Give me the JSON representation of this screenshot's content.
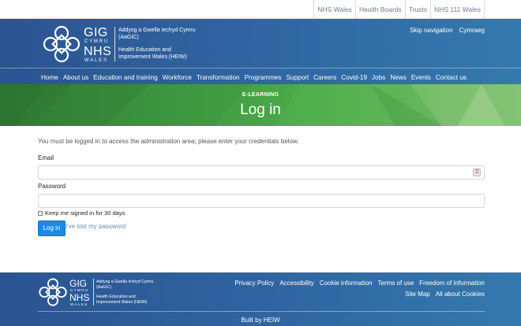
{
  "topbar": {
    "links": [
      "NHS Wales",
      "Health Boards",
      "Trusts",
      "NHS 111 Wales"
    ]
  },
  "header": {
    "logo": {
      "gig": "GIG",
      "cymru": "CYMRU",
      "nhs": "NHS",
      "wales": "WALES",
      "welsh_name": "Addysg a Gwella Iechyd Cymru (AaGIC)",
      "english_name": "Health Education and Improvement Wales (HEIW)"
    },
    "skip_nav": "Skip navigation",
    "language": "Cymraeg"
  },
  "nav": {
    "items": [
      "Home",
      "About us",
      "Education and training",
      "Workforce",
      "Transformation",
      "Programmes",
      "Support",
      "Careers",
      "Covid-19",
      "Jobs",
      "News",
      "Events",
      "Contact us"
    ]
  },
  "hero": {
    "kicker": "E-LEARNING",
    "title": "Log in"
  },
  "login": {
    "notice": "You must be logged in to access the administration area; please enter your credentials below.",
    "email_label": "Email",
    "email_value": "",
    "password_label": "Password",
    "password_value": "",
    "remember_label": "Keep me signed in for 30 days",
    "remember_checked": false,
    "submit_label": "Log in",
    "lost_password": "I've lost my password"
  },
  "footer": {
    "links": [
      "Privacy Policy",
      "Accessibility",
      "Cookie information",
      "Terms of use",
      "Freedom of information",
      "Site Map",
      "All about Cookies"
    ],
    "built_by": "Built by HEIW"
  },
  "colors": {
    "header_blue": "#2f64a0",
    "hero_green": "#3f9a41",
    "button_blue": "#1e88e5",
    "link_blue": "#5d8fc4"
  }
}
